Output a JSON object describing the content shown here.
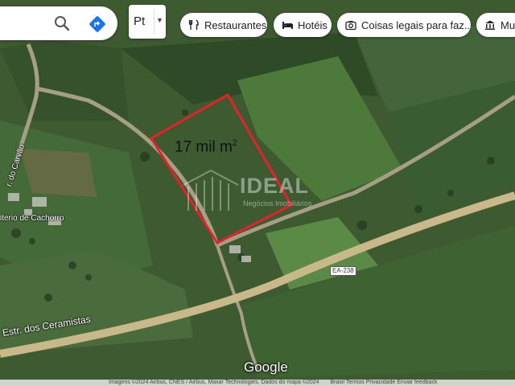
{
  "toolbar": {
    "search_icon": "search-icon",
    "directions_icon": "directions-icon",
    "layer_label": "Pt",
    "chips": [
      {
        "label": "Restaurantes",
        "icon": "restaurant-icon"
      },
      {
        "label": "Hotéis",
        "icon": "hotel-icon"
      },
      {
        "label": "Coisas legais para faz...",
        "icon": "camera-icon"
      },
      {
        "label": "Mus",
        "icon": "museum-icon"
      }
    ]
  },
  "map": {
    "parcel_area": "17 mil m",
    "parcel_area_unit": "2",
    "watermark_title": "IDEAL",
    "watermark_subtitle": "Negócios Imobiliários",
    "places": [
      {
        "label": "r. do Carvão"
      },
      {
        "label": "iterio de Cachorro"
      }
    ],
    "road_name": "Estr. dos Ceramistas",
    "road_shield": "EA-238",
    "logo": "Google",
    "footer_left": "Imagens ©2024 Airbus, CNES / Airbus, Maxar Technologies, Dados do mapa ©2024",
    "footer_right": "Brasil   Termos   Privacidade   Enviar feedback",
    "colors": {
      "parcel_outline": "#e8202a",
      "road": "#c9b98a",
      "directions": "#1a73e8"
    }
  }
}
